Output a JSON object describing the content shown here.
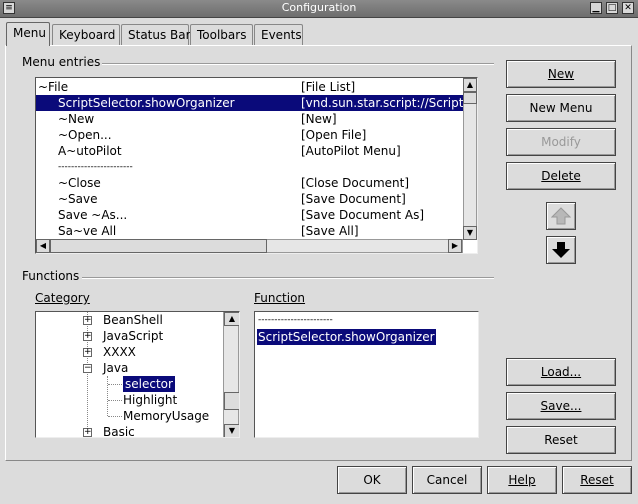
{
  "window": {
    "title": "Configuration"
  },
  "tabs": [
    {
      "label": "Menu"
    },
    {
      "label": "Keyboard"
    },
    {
      "label": "Status Bar"
    },
    {
      "label": "Toolbars"
    },
    {
      "label": "Events"
    }
  ],
  "menu_entries": {
    "label": "Menu entries",
    "rows": [
      {
        "name": "~File",
        "cmd": "[File List]"
      },
      {
        "name": "ScriptSelector.showOrganizer",
        "cmd": "[vnd.sun.star.script://ScriptS"
      },
      {
        "name": "~New",
        "cmd": "[New]"
      },
      {
        "name": "~Open...",
        "cmd": "[Open File]"
      },
      {
        "name": "A~utoPilot",
        "cmd": "[AutoPilot Menu]"
      },
      {
        "name": "-----------------------",
        "cmd": ""
      },
      {
        "name": "~Close",
        "cmd": "[Close Document]"
      },
      {
        "name": "~Save",
        "cmd": "[Save Document]"
      },
      {
        "name": "Save ~As...",
        "cmd": "[Save Document As]"
      },
      {
        "name": "Sa~ve All",
        "cmd": "[Save All]"
      }
    ]
  },
  "side_buttons": {
    "new": "New",
    "new_menu": "New Menu",
    "modify": "Modify",
    "delete": "Delete",
    "load": "Load...",
    "save": "Save...",
    "reset": "Reset"
  },
  "functions": {
    "label": "Functions",
    "category_label": "Category",
    "function_label": "Function",
    "category_items": [
      {
        "label": "BeanShell",
        "expander": "+"
      },
      {
        "label": "JavaScript",
        "expander": "+"
      },
      {
        "label": "XXXX",
        "expander": "+"
      },
      {
        "label": "Java",
        "expander": "−"
      },
      {
        "label": "selector",
        "expander": ""
      },
      {
        "label": "Highlight",
        "expander": ""
      },
      {
        "label": "MemoryUsage",
        "expander": ""
      },
      {
        "label": "Basic",
        "expander": "+"
      }
    ],
    "function_items": [
      {
        "label": "-----------------------"
      },
      {
        "label": "ScriptSelector.showOrganizer"
      }
    ]
  },
  "bottom_buttons": {
    "ok": "OK",
    "cancel": "Cancel",
    "help": "Help",
    "reset": "Reset"
  },
  "colors": {
    "selection": "#0a0a7a",
    "background": "#dcdcdc"
  }
}
